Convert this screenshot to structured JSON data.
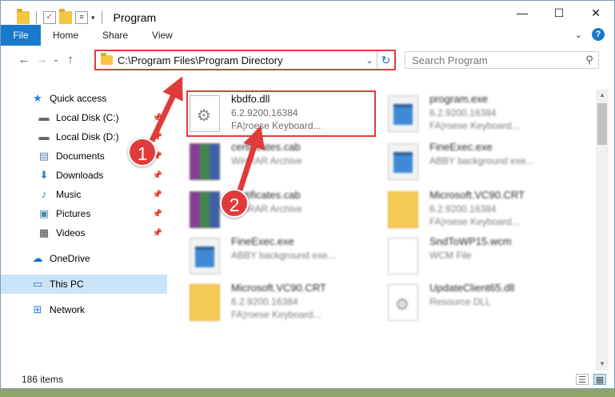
{
  "window": {
    "title": "Program",
    "controls": {
      "minimize": "—",
      "maximize": "☐",
      "close": "✕"
    }
  },
  "ribbon": {
    "file_label": "File",
    "tabs": [
      "Home",
      "Share",
      "View"
    ],
    "expand_icon": "chevron-down-icon",
    "help_label": "?"
  },
  "nav": {
    "back": "←",
    "forward": "→",
    "recent": "⌄",
    "up": "↑"
  },
  "address": {
    "path": "C:\\Program Files\\Program Directory",
    "dropdown": "⌄",
    "refresh": "↻"
  },
  "search": {
    "placeholder": "Search Program",
    "icon": "⚲"
  },
  "sidebar": {
    "items": [
      {
        "label": "Quick access",
        "icon": "★",
        "pinned": false
      },
      {
        "label": "Local Disk (C:)",
        "icon": "▬",
        "pinned": true
      },
      {
        "label": "Local Disk (D:)",
        "icon": "▬",
        "pinned": true
      },
      {
        "label": "Documents",
        "icon": "▤",
        "pinned": true
      },
      {
        "label": "Downloads",
        "icon": "⬇",
        "pinned": true
      },
      {
        "label": "Music",
        "icon": "♪",
        "pinned": true
      },
      {
        "label": "Pictures",
        "icon": "▣",
        "pinned": true
      },
      {
        "label": "Videos",
        "icon": "▦",
        "pinned": true
      },
      {
        "label": "OneDrive",
        "icon": "☁",
        "pinned": false
      },
      {
        "label": "This PC",
        "icon": "▭",
        "pinned": false
      },
      {
        "label": "Network",
        "icon": "⊞",
        "pinned": false
      }
    ]
  },
  "files": [
    {
      "name": "kbdfo.dll",
      "line1": "6.2.9200.16384",
      "line2": "FA¦roese Keyboard...",
      "icon": "dll-icon",
      "highlighted": true
    },
    {
      "name": "program.exe",
      "line1": "6.2.9200.16384",
      "line2": "FA¦roese Keyboard...",
      "icon": "exe-icon"
    },
    {
      "name": "certificates.cab",
      "line1": "WinRAR Archive",
      "line2": "",
      "icon": "rar-icon"
    },
    {
      "name": "FineExec.exe",
      "line1": "ABBY background exe...",
      "line2": "",
      "icon": "exe-icon"
    },
    {
      "name": "certificates.cab",
      "line1": "WinRAR Archive",
      "line2": "",
      "icon": "rar-icon"
    },
    {
      "name": "Microsoft.VC90.CRT",
      "line1": "6.2.9200.16384",
      "line2": "FA¦roese Keyboard...",
      "icon": "folder-icon"
    },
    {
      "name": "FineExec.exe",
      "line1": "ABBY background exe...",
      "line2": "",
      "icon": "exe-icon"
    },
    {
      "name": "SndToWP15.wcm",
      "line1": "WCM File",
      "line2": "",
      "icon": "file-icon"
    },
    {
      "name": "Microsoft.VC90.CRT",
      "line1": "6.2.9200.16384",
      "line2": "FA¦roese Keyboard...",
      "icon": "folder-icon"
    },
    {
      "name": "UpdateClient65.dll",
      "line1": "Resource DLL",
      "line2": "",
      "icon": "dll-icon"
    }
  ],
  "status": {
    "item_count": "186 items"
  },
  "annotations": {
    "step1": "1",
    "step2": "2",
    "color": "#e03b3b"
  }
}
